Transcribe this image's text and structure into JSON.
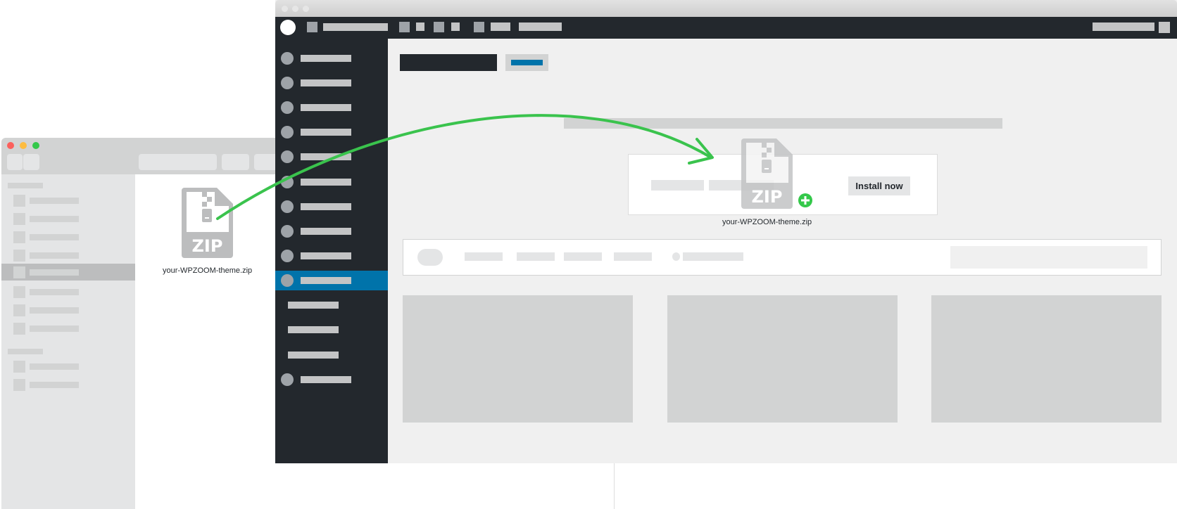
{
  "finder": {
    "traffic_lights": {
      "close": "#fc605c",
      "minimize": "#fdbc40",
      "zoom": "#34c84a"
    },
    "file": {
      "icon": "zip-file-icon",
      "badge": "ZIP",
      "name": "your-WPZOOM-theme.zip"
    },
    "sidebar": {
      "selected_index": 4,
      "section1_count": 8,
      "section2_count": 2
    }
  },
  "wordpress": {
    "admin_bar_color": "#23282d",
    "accent_color": "#0073aa",
    "menu": {
      "active_index": 9,
      "item_count": 10,
      "submenu_count": 3,
      "after_count": 1
    },
    "upload": {
      "dragged_file": {
        "icon": "zip-file-icon",
        "badge": "ZIP",
        "name": "your-WPZOOM-theme.zip",
        "add_badge": "plus-icon"
      },
      "install_label": "Install now"
    },
    "themes_count": 3
  },
  "arrow": {
    "color": "#3ac34d",
    "meaning": "drag-file-to-upload"
  }
}
